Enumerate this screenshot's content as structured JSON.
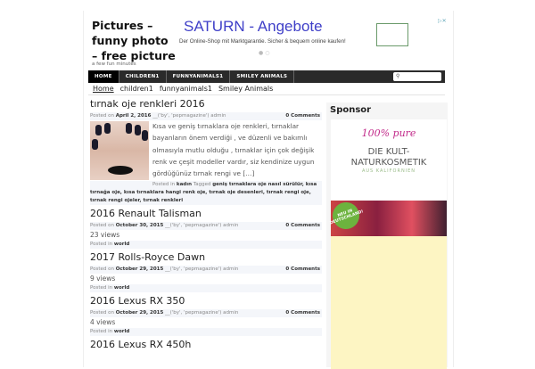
{
  "site": {
    "title": "Pictures – funny photo – free picture",
    "tagline": "a few fun minutes"
  },
  "ad": {
    "headline": "SATURN - Angebote",
    "text": "Der Online-Shop mit Marktgarantie. Sicher & bequem online kaufen!",
    "adchoices": "▷✕"
  },
  "nav": {
    "items": [
      "HOME",
      "CHILDREN1",
      "FUNNYANIMALS1",
      "SMILEY ANIMALS"
    ],
    "search_icon": "search-icon"
  },
  "breadcrumb": [
    "Home",
    "children1",
    "funnyanimals1",
    "Smiley Animals"
  ],
  "posts": [
    {
      "title": "tırnak oje renkleri 2016",
      "posted_on": "Posted on",
      "date": "April 2, 2016",
      "author": "__('by', 'pepmagazine') admin",
      "comments": "0 Comments",
      "excerpt": "Kısa ve geniş tırnaklara oje renkleri, tırnaklar bayanların önem verdiği , ve düzenli ve bakımlı olmasıyla mutlu olduğu , tırnaklar için çok değişik renk ve çeşit modeller vardır, siz kendinize uygun gördüğünüz tırnak rengi ve […]",
      "posted_in": "Posted in",
      "category": "kadın",
      "tagged": "Tagged",
      "tags": "geniş tırnaklara oje nasıl sürülür, kısa tırnağa oje, kısa tırnaklara hangi renk oje, tırnak oje desenleri, tırnak rengi oje, tırnak rengi ojeler, tırnak renkleri"
    },
    {
      "title": "2016 Renault Talisman",
      "posted_on": "Posted on",
      "date": "October 30, 2015",
      "author": "__('by', 'pepmagazine') admin",
      "comments": "0 Comments",
      "views": "23 views",
      "posted_in": "Posted in",
      "category": "world"
    },
    {
      "title": "2017 Rolls-Royce Dawn",
      "posted_on": "Posted on",
      "date": "October 29, 2015",
      "author": "__('by', 'pepmagazine') admin",
      "comments": "0 Comments",
      "views": "9 views",
      "posted_in": "Posted in",
      "category": "world"
    },
    {
      "title": "2016 Lexus RX 350",
      "posted_on": "Posted on",
      "date": "October 29, 2015",
      "author": "__('by', 'pepmagazine') admin",
      "comments": "0 Comments",
      "views": "4 views",
      "posted_in": "Posted in",
      "category": "world"
    },
    {
      "title": "2016 Lexus RX 450h"
    }
  ],
  "sidebar": {
    "heading": "Sponsor",
    "ad": {
      "brand": "100% pure",
      "headline": "DIE KULT-NATURKOSMETIK",
      "sub": "AUS KALIFORNIEN",
      "badge": "NEU IN DEUTSCHLAND!"
    }
  }
}
